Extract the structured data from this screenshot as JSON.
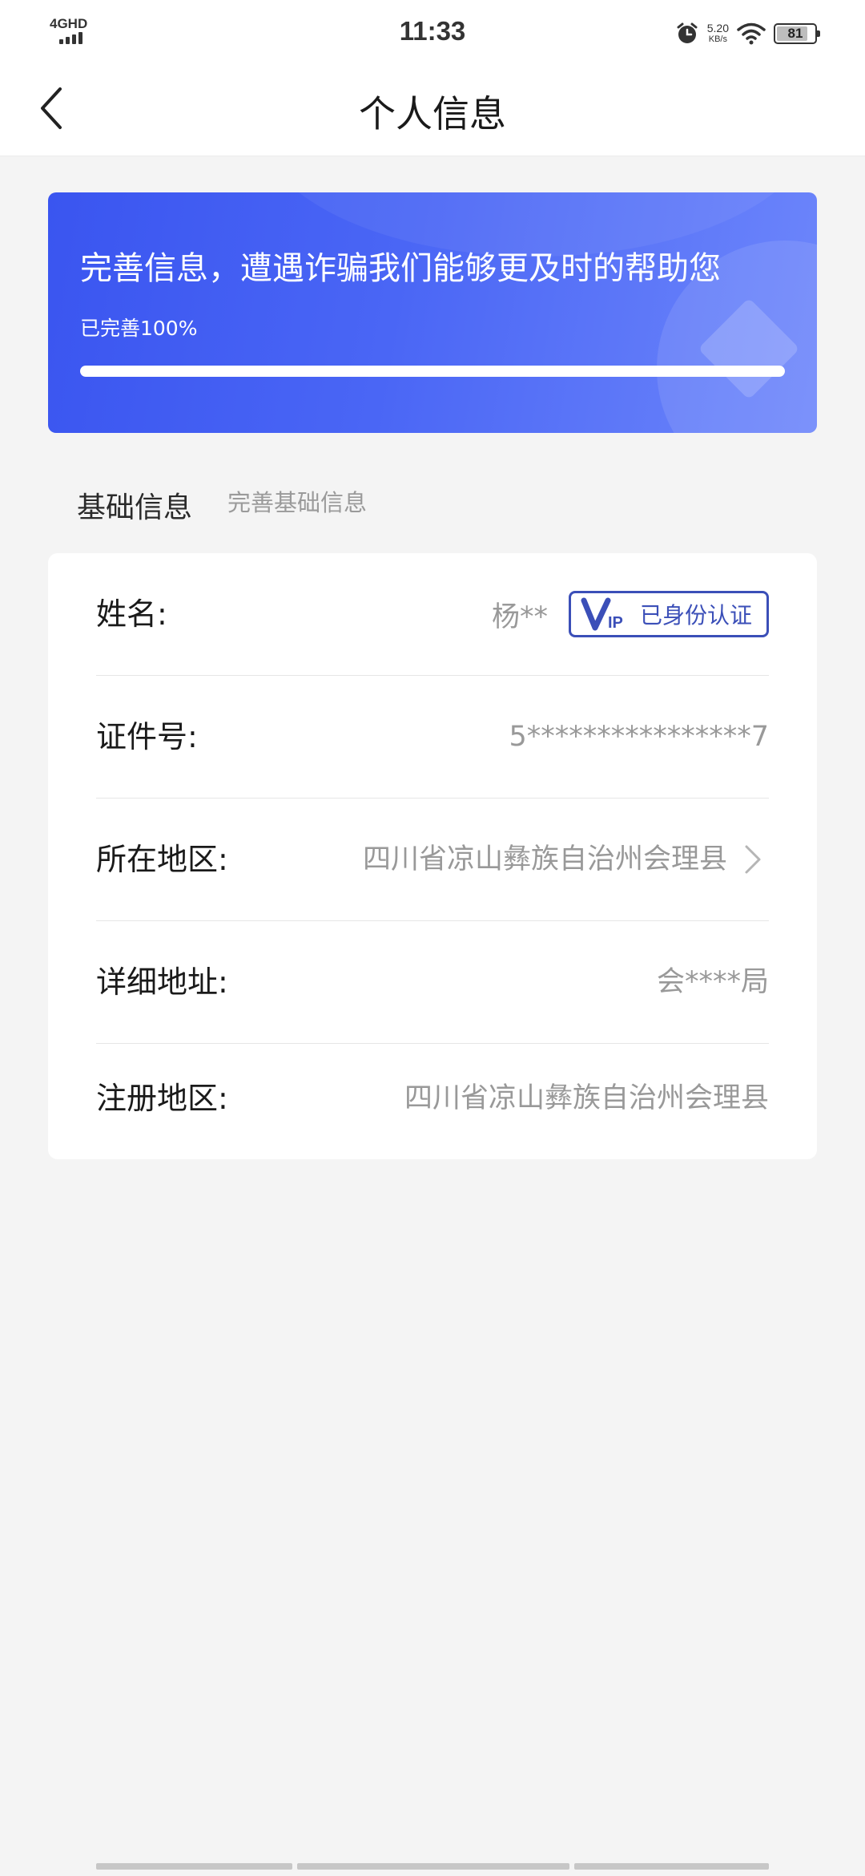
{
  "status_bar": {
    "network": "4GHD",
    "time": "11:33",
    "speed_value": "5.20",
    "speed_unit": "KB/s",
    "battery_level": "81"
  },
  "nav": {
    "title": "个人信息"
  },
  "banner": {
    "title": "完善信息，遭遇诈骗我们能够更及时的帮助您",
    "progress_text": "已完善100%",
    "progress_percent": 100
  },
  "section": {
    "title": "基础信息",
    "hint": "完善基础信息"
  },
  "info_rows": {
    "name": {
      "label": "姓名:",
      "value": "杨**",
      "badge": "已身份认证"
    },
    "id_number": {
      "label": "证件号:",
      "value": "5****************7"
    },
    "region": {
      "label": "所在地区:",
      "value": "四川省凉山彝族自治州会理县"
    },
    "address": {
      "label": "详细地址:",
      "value": "会****局"
    },
    "register_region": {
      "label": "注册地区:",
      "value": "四川省凉山彝族自治州会理县"
    }
  },
  "colors": {
    "accent": "#3a55f0",
    "badge": "#3b4fb8",
    "value_text": "#999999",
    "background": "#f4f4f4"
  }
}
